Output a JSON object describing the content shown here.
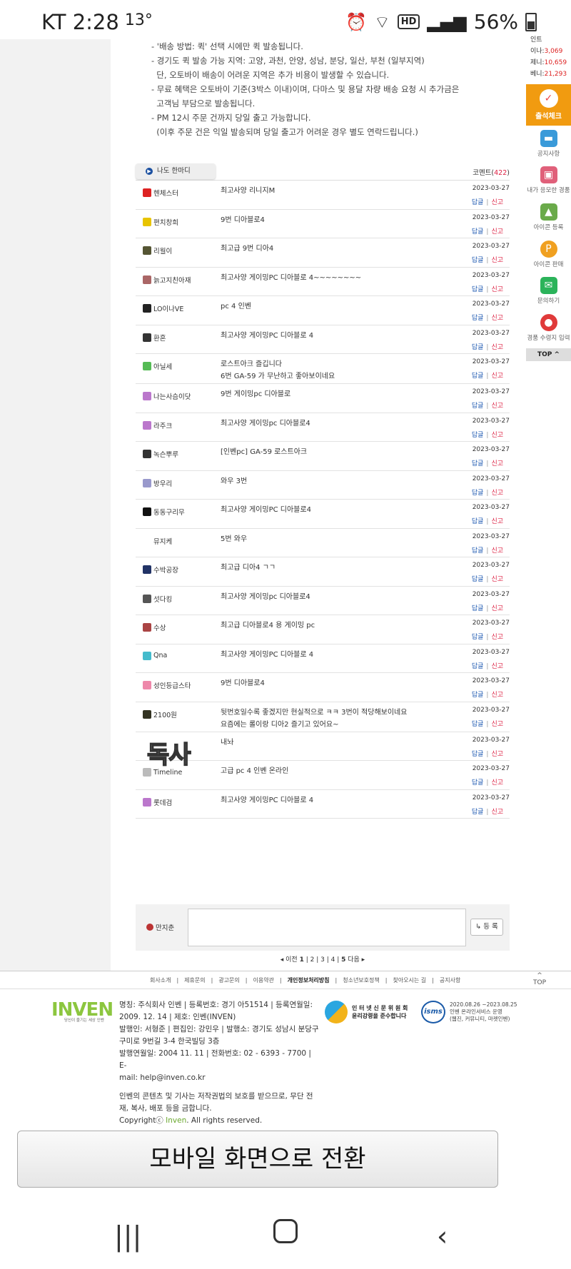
{
  "status": {
    "carrier_time": "KT 2:28",
    "temp": "13°",
    "battery": "56%"
  },
  "notes": [
    "- '배송 방법: 퀵' 선택 시에만 퀵 발송됩니다.",
    "- 경기도 퀵 발송 가능 지역: 고양, 과천, 안양, 성남, 분당, 일산, 부천 (일부지역)",
    "  단, 오토바이 배송이 어려운 지역은 추가 비용이 발생할 수 있습니다.",
    "- 무료 혜택은 오토바이 기준(3박스 이내)이며, 다마스 및 용달 차량 배송 요청 시 추가금은",
    "  고객님 부담으로 발송됩니다.",
    "- PM 12시 주문 건까지 당일 출고 가능합니다.",
    "  (이후 주문 건은 익일 발송되며 당일 출고가 어려운 경우 별도 연락드립니다.)"
  ],
  "comment_header": {
    "tab": "나도 한마디",
    "count_label": "코멘트(",
    "count": "422",
    "count_close": ")"
  },
  "actions": {
    "reply": "답글",
    "sep": "|",
    "report": "신고"
  },
  "comments": [
    {
      "nick": "헨체스터",
      "icon_color": "#d22",
      "lines": [
        "최고사양 리니지M"
      ],
      "date": "2023-03-27"
    },
    {
      "nick": "편치창희",
      "icon_color": "#e8c400",
      "lines": [
        "9번 디아블로4"
      ],
      "date": "2023-03-27"
    },
    {
      "nick": "리월이",
      "icon_color": "#553",
      "lines": [
        "최고급 9번 디아4"
      ],
      "date": "2023-03-27"
    },
    {
      "nick": "늙고지친아재",
      "icon_color": "#a66",
      "lines": [
        "최고사양 게이밍PC 디아블로 4~~~~~~~~"
      ],
      "date": "2023-03-27"
    },
    {
      "nick": "LO이나VE",
      "icon_color": "#222",
      "lines": [
        "pc 4 인벤"
      ],
      "date": "2023-03-27"
    },
    {
      "nick": "환혼",
      "icon_color": "#333",
      "lines": [
        "최고사양 게이밍PC 디아블로 4"
      ],
      "date": "2023-03-27"
    },
    {
      "nick": "아닐세",
      "icon_color": "#5b5",
      "lines": [
        "로스트아크 즐깁니다",
        "6번 GA-59 가 무난하고 좋아보이네요"
      ],
      "date": "2023-03-27"
    },
    {
      "nick": "나는사슴이닷",
      "icon_color": "#b7c",
      "lines": [
        "9번 게이밍pc 디아블로"
      ],
      "date": "2023-03-27"
    },
    {
      "nick": "라주크",
      "icon_color": "#b7c",
      "lines": [
        "최고사양 게이밍pc 디아블로4"
      ],
      "date": "2023-03-27"
    },
    {
      "nick": "녹슨뿌루",
      "icon_color": "#333",
      "lines": [
        "[인벤pc] GA-59 로스트아크"
      ],
      "date": "2023-03-27"
    },
    {
      "nick": "방우리",
      "icon_color": "#99c",
      "lines": [
        "와우 3번"
      ],
      "date": "2023-03-27"
    },
    {
      "nick": "동동구리무",
      "icon_color": "#111",
      "lines": [
        "최고사양 게이밍PC 디아블로4"
      ],
      "date": "2023-03-27"
    },
    {
      "nick": "뮤지케",
      "icon_color": "transparent",
      "lines": [
        "5번 와우"
      ],
      "date": "2023-03-27"
    },
    {
      "nick": "수박공장",
      "icon_color": "#236",
      "lines": [
        "최고급 디아4 ㄱㄱ"
      ],
      "date": "2023-03-27"
    },
    {
      "nick": "섯다킹",
      "icon_color": "#555",
      "lines": [
        "최고사양 게이밍pc 디아블로4"
      ],
      "date": "2023-03-27"
    },
    {
      "nick": "수상",
      "icon_color": "#a44",
      "lines": [
        "최고급 디아블로4 용 게이밍 pc"
      ],
      "date": "2023-03-27"
    },
    {
      "nick": "Qna",
      "icon_color": "#4bc",
      "lines": [
        "최고사양 게이밍PC 디아블로 4"
      ],
      "date": "2023-03-27"
    },
    {
      "nick": "성인등급스타",
      "icon_color": "#e8a",
      "lines": [
        "9번 디아블로4"
      ],
      "date": "2023-03-27"
    },
    {
      "nick": "2100원",
      "icon_color": "#332",
      "lines": [
        "뒷번호일수록 좋겠지만 현실적으로 ㅋㅋ 3번이 적당해보이네요",
        "요즘에는 롤이랑 디아2 즐기고 있어요~"
      ],
      "date": "2023-03-27"
    },
    {
      "nick": "",
      "stamp": "독사",
      "icon_color": "transparent",
      "lines": [
        "내놔"
      ],
      "date": "2023-03-27"
    },
    {
      "nick": "Timeline",
      "icon_color": "#bbb",
      "lines": [
        "고급 pc 4 인벤 온라인"
      ],
      "date": "2023-03-27"
    },
    {
      "nick": "롯데검",
      "icon_color": "#b7c",
      "lines": [
        "최고사양 게이밍PC 디아블로 4"
      ],
      "date": "2023-03-27"
    }
  ],
  "write": {
    "nick": "만지춘",
    "button": "↳ 등 록"
  },
  "pager": {
    "prev": "◂ 이전",
    "p1": "1",
    "p2": "2",
    "p3": "3",
    "p4": "4",
    "p5": "5",
    "next": "다음 ▸"
  },
  "right_bar": {
    "stats": [
      {
        "label": "인트",
        "value": ""
      },
      {
        "label": "이나:",
        "value": "3,069"
      },
      {
        "label": "제니:",
        "value": "10,659"
      },
      {
        "label": "베니:",
        "value": "21,293"
      }
    ],
    "check": "출석체크",
    "items": [
      "공지사항",
      "내가 응모한 경품",
      "아이콘 등록",
      "아이콘 판매",
      "문의하기",
      "경품 수령지 입력"
    ],
    "top": "TOP ^"
  },
  "footer": {
    "links": [
      "회사소개",
      "제휴문의",
      "광고문의",
      "이용약관",
      "개인정보처리방침",
      "청소년보호정책",
      "찾아오시는 길",
      "공지사항"
    ],
    "top": "TOP",
    "logo": "INVEN",
    "logo_sub": "당신이 즐기는 세상 인벤",
    "info": [
      "명칭: 주식회사 인벤 | 등록번호: 경기 아51514 | 등록연월일:",
      "2009. 12. 14 | 제호: 인벤(INVEN)",
      "발행인: 서형준 | 편집인: 강민우 | 발행소: 경기도 성남시 분당구",
      "구미로 9번길 3-4 한국빌딩 3층",
      "발행연월일: 2004 11. 11 | 전화번호: 02 - 6393 - 7700 | E-",
      "mail: help@inven.co.kr"
    ],
    "copy1": "인벤의 콘텐츠 및 기사는 저작권법의 보호를 받으므로, 무단 전",
    "copy2": "재, 복사, 배포 등을 금합니다.",
    "copyright": "Copyrightⓒ ",
    "copyright_brand": "Inven",
    "copyright_end": ". All rights reserved.",
    "badge1": [
      "인 터 넷 신 문 위 원 회",
      "윤리강령을 준수합니다"
    ],
    "badge2_logo": "isms",
    "badge2": [
      "2020.08.26 ~2023.08.25",
      "인벤 온라인서비스 운영",
      "(웹진, 커뮤니티, 마켓인벤)"
    ]
  },
  "mobile_button": "모바일 화면으로 전환"
}
